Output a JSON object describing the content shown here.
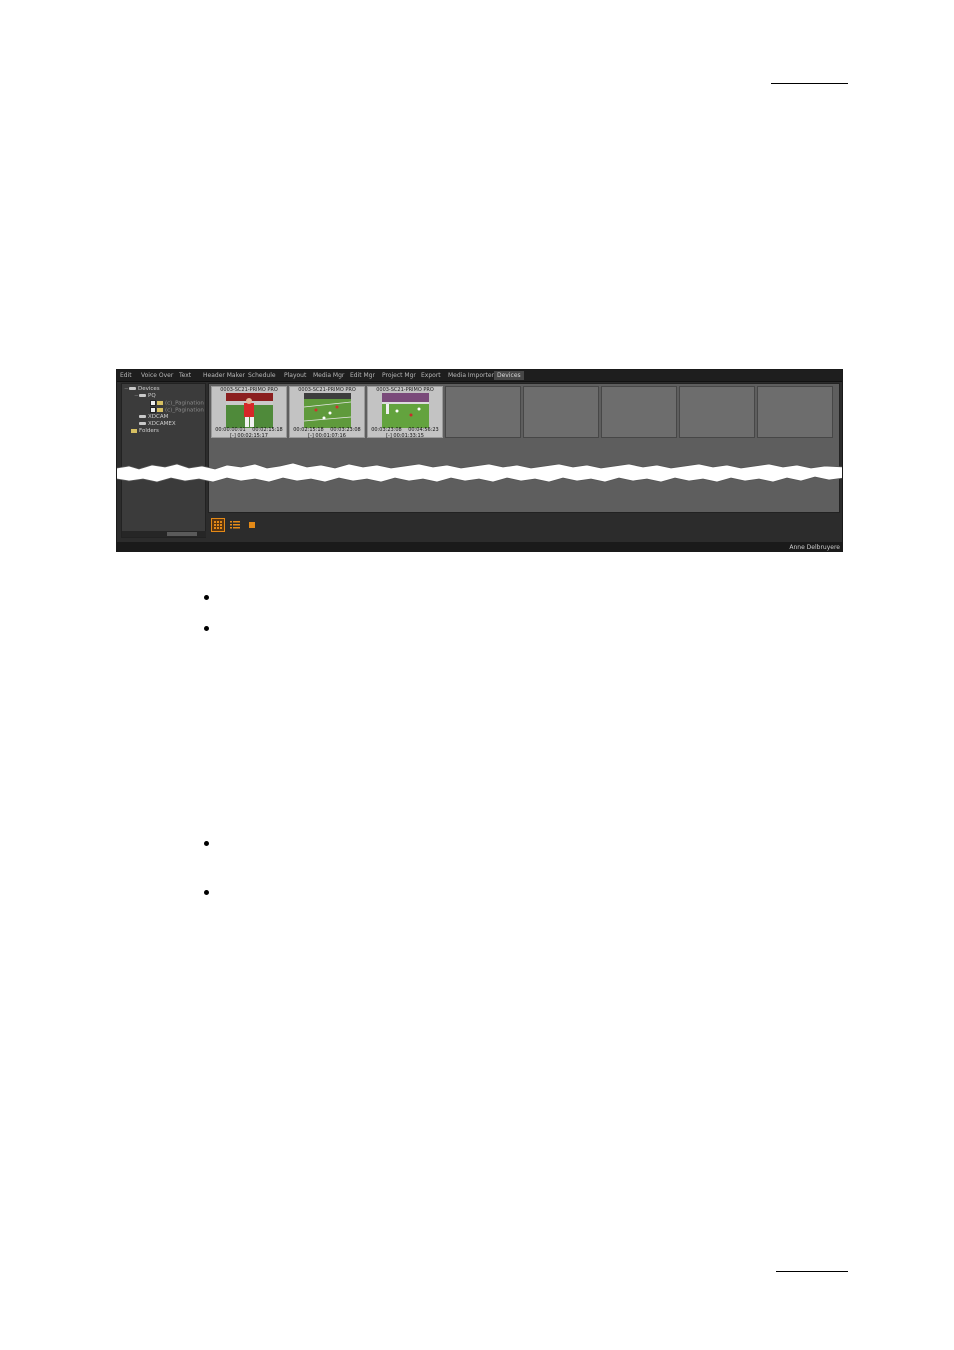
{
  "app": {
    "menu": [
      "Edit",
      "Voice Over",
      "Text",
      "Header Maker",
      "Schedule",
      "Playout",
      "Media Mgr",
      "Edit Mgr",
      "Project Mgr",
      "Export",
      "Media Importer",
      "Devices"
    ],
    "active_tab": "Devices"
  },
  "tree": {
    "root": "Devices",
    "pq": "PQ",
    "pq_child1": "(c)_Pagination",
    "pq_child2": "(c)_Pagination",
    "xdcam": "XDCAM",
    "xdcamex": "XDCAMEX",
    "folders": "Folders"
  },
  "clips": [
    {
      "title": "0003-SC21-PRIMO PRO",
      "tc_in": "00:00:00:01",
      "tc_out": "00:02:15:18",
      "duration": "[-] 00:02:15:17"
    },
    {
      "title": "0003-SC21-PRIMO PRO",
      "tc_in": "00:02:15:18",
      "tc_out": "00:03:23:08",
      "duration": "[-] 00:01:07:16"
    },
    {
      "title": "0003-SC21-PRIMO PRO",
      "tc_in": "00:03:23:08",
      "tc_out": "00:04:56:23",
      "duration": "[-] 00:01:33:15"
    }
  ],
  "view_buttons": [
    {
      "icon": "grid-view-icon",
      "selected": true
    },
    {
      "icon": "list-view-icon",
      "selected": false
    },
    {
      "icon": "single-view-icon",
      "selected": false
    }
  ],
  "status": {
    "user": "Anne Delbruyere"
  },
  "colors": {
    "accent": "#e48a17",
    "background": "#2c2c2c",
    "panel": "#5e5e5e"
  }
}
